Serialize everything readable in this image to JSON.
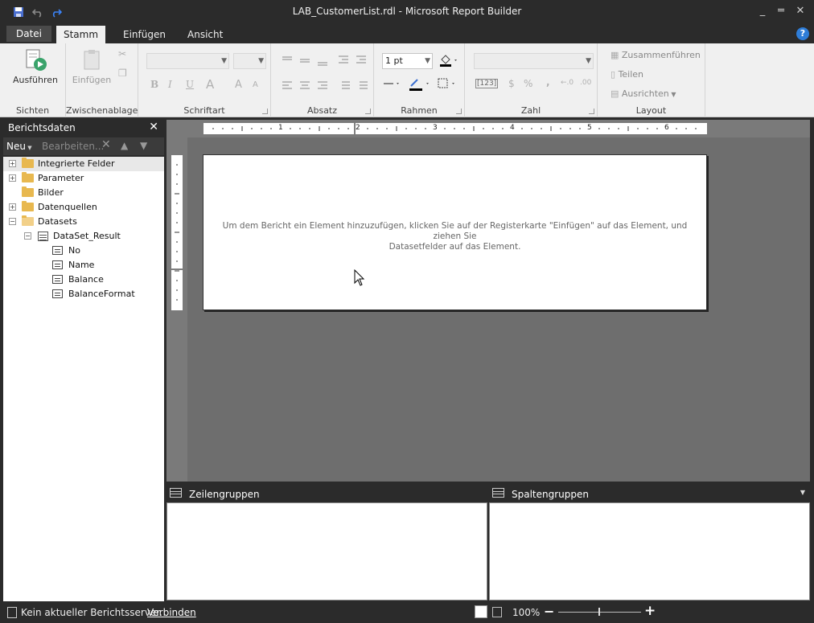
{
  "window": {
    "title": "LAB_CustomerList.rdl - Microsoft Report Builder",
    "minimize_glyph": "_",
    "maximize_glyph": "═",
    "close_glyph": "✕"
  },
  "tabs": [
    {
      "label": "Datei"
    },
    {
      "label": "Stamm"
    },
    {
      "label": "Einfügen"
    },
    {
      "label": "Ansicht"
    }
  ],
  "help_glyph": "?",
  "ribbon": {
    "sichten": {
      "label": "Sichten",
      "run_label": "Ausführen"
    },
    "zwischenablage": {
      "label": "Zwischenablage",
      "paste_label": "Einfügen"
    },
    "schriftart": {
      "label": "Schriftart",
      "bold": "B",
      "italic": "I",
      "underline": "U",
      "fontcolor": "A",
      "grow": "A",
      "shrink": "A"
    },
    "absatz": {
      "label": "Absatz"
    },
    "rahmen": {
      "label": "Rahmen",
      "border_width": "1 pt"
    },
    "zahl": {
      "label": "Zahl",
      "placeholder": "[123]",
      "currency": "$",
      "percent": "%",
      "comma": ","
    },
    "layout": {
      "label": "Layout",
      "merge": "Zusammenführen",
      "split": "Teilen",
      "align": "Ausrichten"
    }
  },
  "left_panel": {
    "title": "Berichtsdaten",
    "close_glyph": "✕",
    "new_label": "Neu",
    "edit_label": "Bearbeiten...",
    "tree": [
      {
        "label": "Integrierte Felder",
        "expander": "+"
      },
      {
        "label": "Parameter",
        "expander": "+"
      },
      {
        "label": "Bilder",
        "expander": ""
      },
      {
        "label": "Datenquellen",
        "expander": "+"
      },
      {
        "label": "Datasets",
        "expander": "−"
      },
      {
        "label": "DataSet_Result",
        "expander": "−"
      },
      {
        "label": "No"
      },
      {
        "label": "Name"
      },
      {
        "label": "Balance"
      },
      {
        "label": "BalanceFormat"
      }
    ]
  },
  "ruler": {
    "ticks": [
      "1",
      "2",
      "3",
      "4",
      "5",
      "6"
    ]
  },
  "report": {
    "hint_line1": "Um dem Bericht ein Element hinzuzufügen, klicken Sie auf der Registerkarte \"Einfügen\" auf das Element, und ziehen Sie",
    "hint_line2": "Datasetfelder auf das Element."
  },
  "groups": {
    "row_label": "Zeilengruppen",
    "column_label": "Spaltengruppen"
  },
  "status": {
    "server_text": "Kein aktueller Berichtsserver.",
    "connect_label": "Verbinden",
    "zoom": "100%"
  },
  "colors": {
    "chrome": "#2b2b2b",
    "ribbon": "#f0f0f0",
    "canvas": "#6e6e6e",
    "accent": "#2e7dd8",
    "folder": "#e8b84f"
  }
}
